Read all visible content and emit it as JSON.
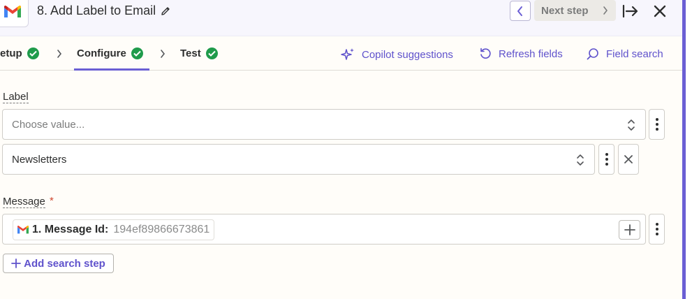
{
  "header": {
    "title": "8. Add Label to Email",
    "app_icon": "gmail-logo",
    "next_step_label": "Next step",
    "icons": {
      "edit": "pencil-icon",
      "prev": "chevron-left-icon",
      "next": "chevron-right-icon",
      "expand": "arrow-right-to-bar-icon",
      "close": "close-icon"
    }
  },
  "tabs": [
    {
      "label": "Setup",
      "status": "complete"
    },
    {
      "label": "Configure",
      "status": "complete",
      "active": true
    },
    {
      "label": "Test",
      "status": "complete"
    }
  ],
  "tools": {
    "copilot": "Copilot suggestions",
    "refresh": "Refresh fields",
    "search": "Field search"
  },
  "label_field": {
    "label": "Label",
    "placeholder": "Choose value...",
    "selected_value": "Newsletters"
  },
  "message_field": {
    "label": "Message",
    "required_mark": "*",
    "token_label": "1. Message Id:",
    "token_value": "194ef89866673861"
  },
  "add_search_step": "Add search step",
  "colors": {
    "accent": "#6b5fd4",
    "success": "#1f9b4b",
    "required": "#d0472f",
    "header_bg": "#f7f6fd",
    "page_bg": "#fffdf9"
  }
}
